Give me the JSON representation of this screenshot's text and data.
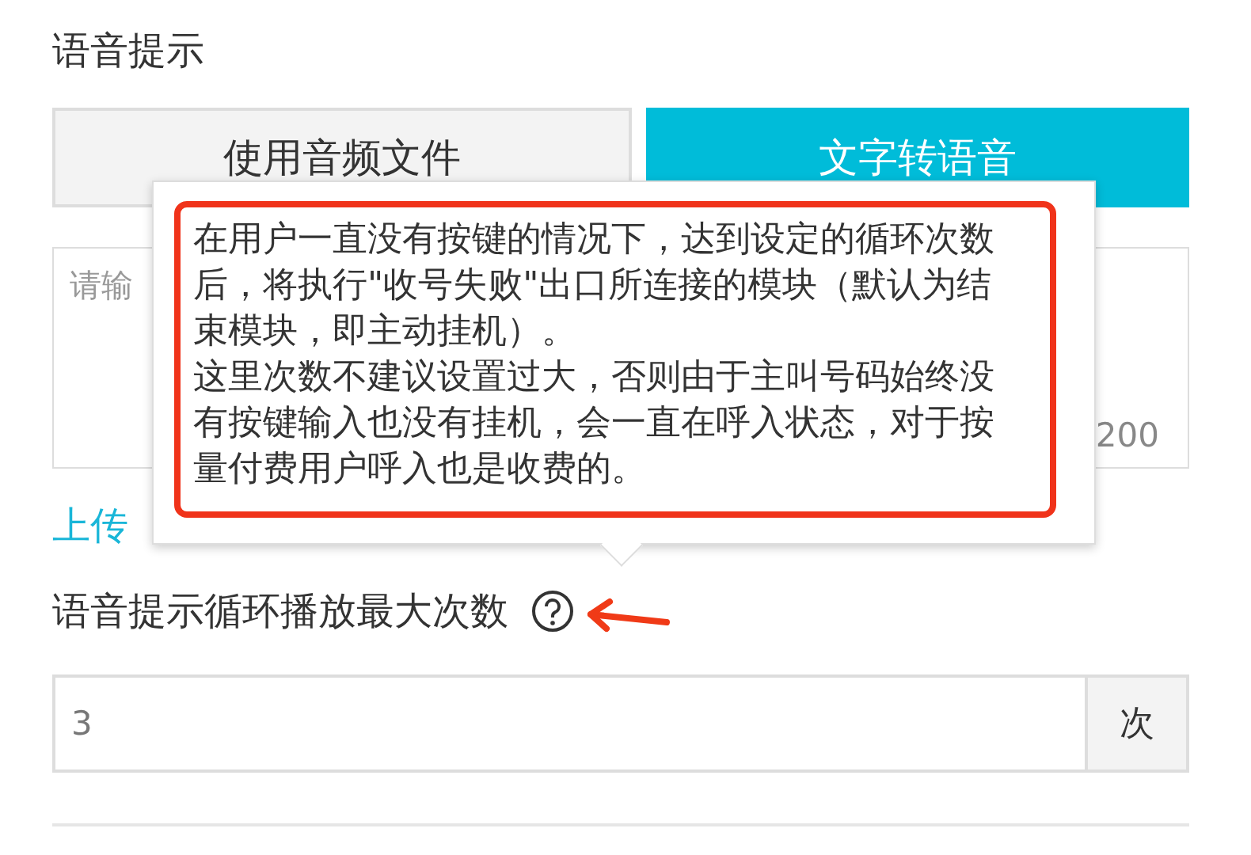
{
  "section_title": "语音提示",
  "tabs": [
    {
      "label": "使用音频文件",
      "selected": false
    },
    {
      "label": "文字转语音",
      "selected": true
    }
  ],
  "text_area": {
    "placeholder": "请输",
    "counter": "200"
  },
  "upload_link": "上传",
  "tooltip": {
    "paragraphs": [
      "在用户一直没有按键的情况下，达到设定的循环次数后，将执行\"收号失败\"出口所连接的模块（默认为结束模块，即主动挂机）。",
      "这里次数不建议设置过大，否则由于主叫号码始终没有按键输入也没有挂机，会一直在呼入状态，对于按量付费用户呼入也是收费的。"
    ]
  },
  "max_loops": {
    "label": "语音提示循环播放最大次数",
    "value": "3",
    "unit": "次"
  }
}
